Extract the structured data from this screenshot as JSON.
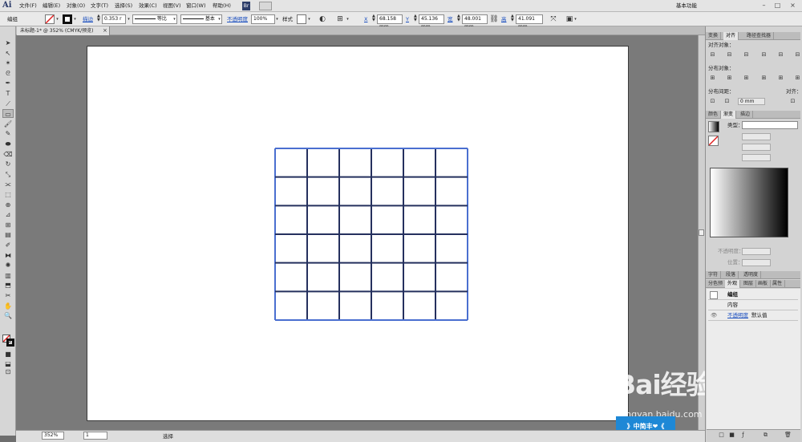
{
  "app": {
    "logo": "Ai",
    "workspace": "基本功能"
  },
  "menu": [
    "文件(F)",
    "编辑(E)",
    "对象(O)",
    "文字(T)",
    "选择(S)",
    "效果(C)",
    "视图(V)",
    "窗口(W)",
    "帮助(H)"
  ],
  "menu_icons": {
    "br": "Br"
  },
  "window_controls": [
    "–",
    "□",
    "×"
  ],
  "control": {
    "selection_label": "编组",
    "stroke_label": "描边",
    "stroke_value": "0.353 r",
    "profile_1": "等比",
    "profile_2": "基本",
    "opacity_label": "不透明度",
    "opacity_value": "100%",
    "style_label": "样式",
    "x_label": "X",
    "x_value": "68.158 mm",
    "y_label": "Y",
    "y_value": "45.136 mm",
    "w_label": "宽",
    "w_value": "48.001 mm",
    "h_label": "高",
    "h_value": "41.091 mm"
  },
  "document": {
    "tab_title": "未标题-1* @ 352% (CMYK/预览)",
    "close": "×"
  },
  "grid": {
    "rows": 6,
    "cols": 6,
    "stroke_color": "#25305e",
    "selection_color": "#4a6fd0"
  },
  "status": {
    "zoom": "352%",
    "page": "1",
    "tool": "选择"
  },
  "panels": {
    "align_tabs": [
      "变换",
      "对齐",
      "路径查找器"
    ],
    "align_objects": "对齐对象：",
    "distribute_objects": "分布对象：",
    "distribute_spacing": "分布间距：",
    "align_to": "对齐：",
    "spacing_value": "0 mm",
    "gradient_tabs": [
      "颜色",
      "渐变",
      "描边"
    ],
    "gradient_type_label": "类型：",
    "gradient_opacity_label": "不透明度：",
    "gradient_location_label": "位置：",
    "char_tabs": [
      "字符",
      "段落",
      "透明度"
    ],
    "appearance_tabs": [
      "分色预",
      "外观",
      "图层",
      "画板",
      "属性"
    ],
    "appearance_rows": [
      {
        "label": "编组"
      },
      {
        "label": "内容"
      },
      {
        "label": "不透明度",
        "value": "默认值"
      }
    ]
  },
  "watermark": {
    "text": "Bai经验",
    "url": "jingyan.baidu.com",
    "badge": "》中简丰❤《"
  }
}
